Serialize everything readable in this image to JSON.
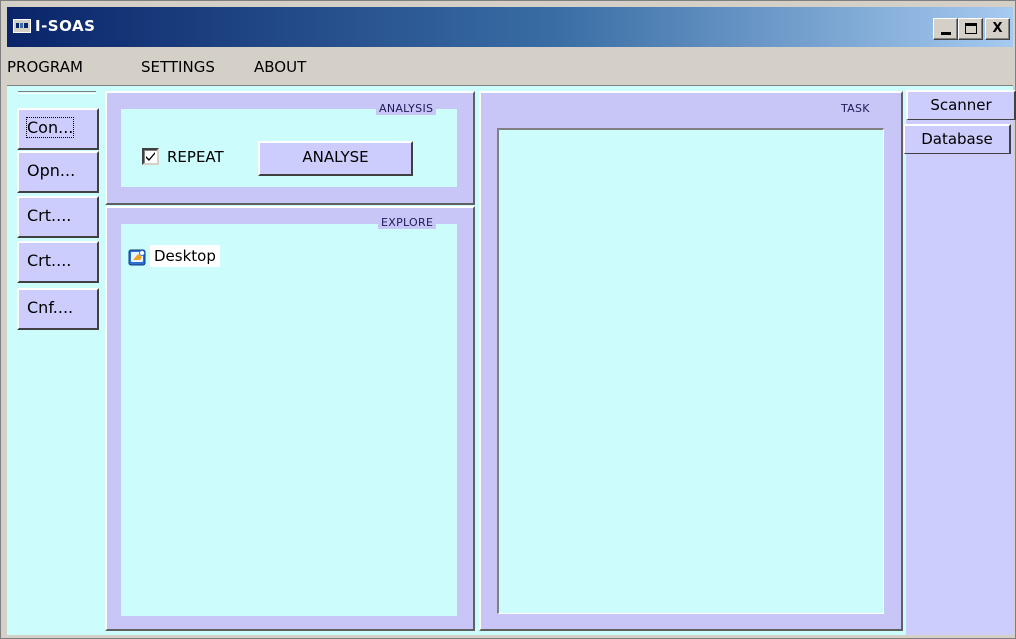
{
  "window": {
    "title": "I-SOAS",
    "icon_text": "I-SOAS",
    "controls": {
      "minimize": "_",
      "maximize": "□",
      "close": "X"
    }
  },
  "menu": {
    "items": [
      {
        "label": "PROGRAM"
      },
      {
        "label": "SETTINGS"
      },
      {
        "label": "ABOUT"
      }
    ]
  },
  "sidebar": {
    "buttons": [
      {
        "label": "Con..."
      },
      {
        "label": "Opn..."
      },
      {
        "label": "Crt...."
      },
      {
        "label": "Crt...."
      },
      {
        "label": "Cnf...."
      }
    ]
  },
  "analysis": {
    "caption": "ANALYSIS",
    "repeat_label": "REPEAT",
    "repeat_checked": true,
    "analyse_label": "ANALYSE"
  },
  "explore": {
    "caption": "EXPLORE",
    "items": [
      {
        "label": "Desktop",
        "icon": "desktop-icon"
      }
    ]
  },
  "task": {
    "caption": "TASK"
  },
  "tabs": [
    {
      "label": "Scanner"
    },
    {
      "label": "Database"
    }
  ],
  "colors": {
    "client_bg": "#ccfcfc",
    "panel_frame": "#c8c6f6",
    "button_face": "#cccdfc",
    "title_gradient_start": "#0a246a",
    "title_gradient_end": "#a6caf0"
  }
}
